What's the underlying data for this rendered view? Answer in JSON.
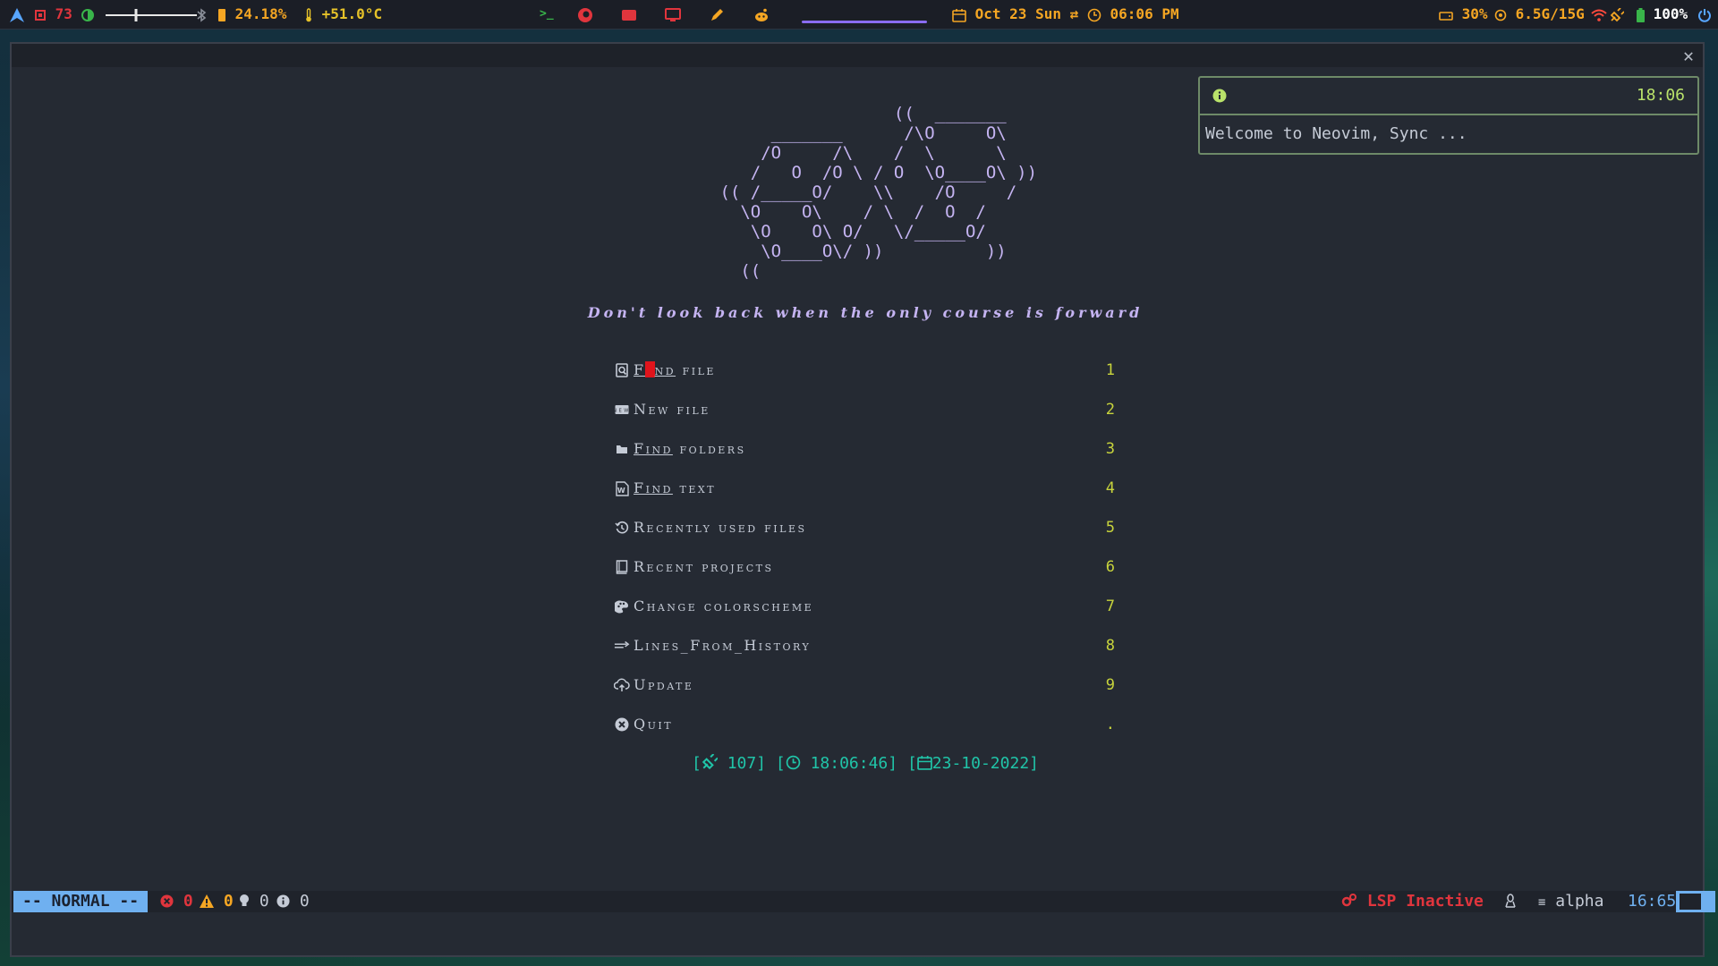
{
  "topbar": {
    "cpu_temp_count": "73",
    "cpu_percent": "24.18%",
    "temperature": "+51.0°C",
    "date": "Oct 23 Sun",
    "time": "06:06 PM",
    "disk": "30%",
    "memory": "6.5G/15G",
    "battery": "100%",
    "colors": {
      "red": "#e0353d",
      "orange": "#f5a623",
      "green": "#39b54a",
      "yellow": "#e6c229",
      "accent": "#8a6cf0",
      "wifi": "#ff4a3d",
      "blue": "#58a6ff"
    }
  },
  "window": {
    "close_label": "✕"
  },
  "dashboard": {
    "logo_lines": [
      "                  ((  _______",
      "      _______      /\\O     O\\",
      "     /O     /\\    /  \\      \\",
      "    /   O  /O \\ / O  \\O____O\\ ))",
      " (( /_____O/    \\\\    /O     /",
      "   \\O    O\\    / \\  /  O  /",
      "    \\O    O\\ O/   \\/_____O/",
      "     \\O____O\\/ ))          ))",
      "   (("
    ],
    "quote": "Don't look back when the only course is forward",
    "menu": [
      {
        "icon": "search-file-icon",
        "hl": "Find",
        "rest": " file",
        "key": "1"
      },
      {
        "icon": "new-file-icon",
        "hl": "",
        "rest": "New file",
        "key": "2"
      },
      {
        "icon": "folder-icon",
        "hl": "Find",
        "rest": " folders",
        "key": "3"
      },
      {
        "icon": "text-file-icon",
        "hl": "Find",
        "rest": " text",
        "key": "4"
      },
      {
        "icon": "history-icon",
        "hl": "",
        "rest": "Recently used files",
        "key": "5"
      },
      {
        "icon": "book-icon",
        "hl": "",
        "rest": "Recent projects",
        "key": "6"
      },
      {
        "icon": "palette-icon",
        "hl": "",
        "rest": "Change colorscheme",
        "key": "7"
      },
      {
        "icon": "lines-icon",
        "hl": "",
        "rest": "Lines_From_History",
        "key": "8"
      },
      {
        "icon": "cloud-upload-icon",
        "hl": "",
        "rest": "Update",
        "key": "9"
      },
      {
        "icon": "quit-icon",
        "hl": "",
        "rest": "Quit",
        "key": "."
      }
    ],
    "footer": {
      "plugins": "107",
      "clock": "18:06:46",
      "date": "23-10-2022"
    }
  },
  "notification": {
    "time": "18:06",
    "message": "Welcome to Neovim, Sync ..."
  },
  "statusline": {
    "mode": "-- NORMAL --",
    "errors": "0",
    "warnings": "0",
    "hints": "0",
    "infos": "0",
    "lsp": "LSP Inactive",
    "filetype": "alpha",
    "position": "16:65"
  }
}
